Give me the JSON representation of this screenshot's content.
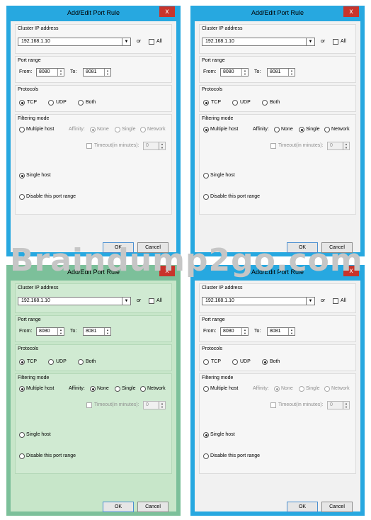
{
  "dialog": {
    "title": "Add/Edit Port Rule",
    "close_glyph": "x",
    "cluster_ip_label": "Cluster IP address",
    "cluster_ip_value": "192.168.1.10",
    "or_label": "or",
    "all_label": "All",
    "port_range_label": "Port range",
    "from_label": "From:",
    "from_value": "8080",
    "to_label": "To:",
    "to_value": "8081",
    "protocols_label": "Protocols",
    "protocol_tcp": "TCP",
    "protocol_udp": "UDP",
    "protocol_both": "Both",
    "filtering_label": "Filtering mode",
    "multiple_host": "Multiple host",
    "affinity_label": "Affinity:",
    "affinity_none": "None",
    "affinity_single": "Single",
    "affinity_network": "Network",
    "timeout_label": "Timeout(in minutes):",
    "timeout_value": "0",
    "single_host": "Single host",
    "disable_range": "Disable this port range",
    "ok": "OK",
    "cancel": "Cancel"
  },
  "watermark": "Braindump2go.com",
  "colors": {
    "frame": "#27a8e0",
    "frame_highlighted": "#7cc09a",
    "close": "#c9342b"
  },
  "panels": [
    {
      "protocol": "TCP",
      "filtering": "Single host",
      "affinity": "None",
      "highlighted": false
    },
    {
      "protocol": "TCP",
      "filtering": "Multiple host",
      "affinity": "Single",
      "highlighted": false
    },
    {
      "protocol": "TCP",
      "filtering": "Multiple host",
      "affinity": "None",
      "highlighted": true
    },
    {
      "protocol": "Both",
      "filtering": "Single host",
      "affinity": "None",
      "highlighted": false
    }
  ]
}
